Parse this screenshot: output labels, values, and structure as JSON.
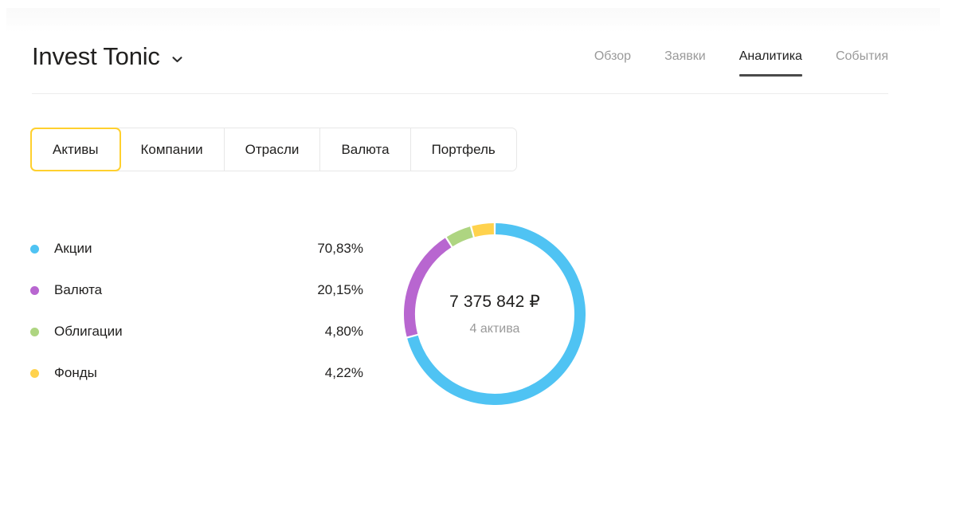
{
  "header": {
    "title": "Invest Tonic",
    "dropdown_icon": "chevron-down-icon",
    "nav": [
      {
        "label": "Обзор",
        "active": false
      },
      {
        "label": "Заявки",
        "active": false
      },
      {
        "label": "Аналитика",
        "active": true
      },
      {
        "label": "События",
        "active": false
      }
    ]
  },
  "tabs": [
    {
      "label": "Активы",
      "selected": true
    },
    {
      "label": "Компании",
      "selected": false
    },
    {
      "label": "Отрасли",
      "selected": false
    },
    {
      "label": "Валюта",
      "selected": false
    },
    {
      "label": "Портфель",
      "selected": false
    }
  ],
  "legend": [
    {
      "label": "Акции",
      "value": "70,83%",
      "color": "#4fc3f3"
    },
    {
      "label": "Валюта",
      "value": "20,15%",
      "color": "#b866d0"
    },
    {
      "label": "Облигации",
      "value": "4,80%",
      "color": "#aed581"
    },
    {
      "label": "Фонды",
      "value": "4,22%",
      "color": "#ffd24d"
    }
  ],
  "donut": {
    "total": "7 375 842 ₽",
    "subtitle": "4 актива"
  },
  "colors": {
    "accent_yellow": "#ffd02e",
    "active_nav_underline": "#4a4a4a",
    "muted_text": "#9a9a9a",
    "border": "#e7e7e7"
  },
  "chart_data": {
    "type": "pie",
    "title": "",
    "subtitle": "",
    "variant": "donut",
    "start_angle_deg": -90,
    "direction": "clockwise",
    "center_label": "7 375 842 ₽",
    "center_sublabel": "4 актива",
    "total_value": 7375842,
    "total_currency": "₽",
    "asset_count": 4,
    "categories": [
      "Акции",
      "Валюта",
      "Облигации",
      "Фонды"
    ],
    "values": [
      70.83,
      20.15,
      4.8,
      4.22
    ],
    "value_unit": "%",
    "colors": [
      "#4fc3f3",
      "#b866d0",
      "#aed581",
      "#ffd24d"
    ],
    "legend": "left",
    "grid": false,
    "geometry": {
      "outer_radius_px": 114,
      "stroke_width_px": 14,
      "gap_deg": 1.2
    }
  }
}
